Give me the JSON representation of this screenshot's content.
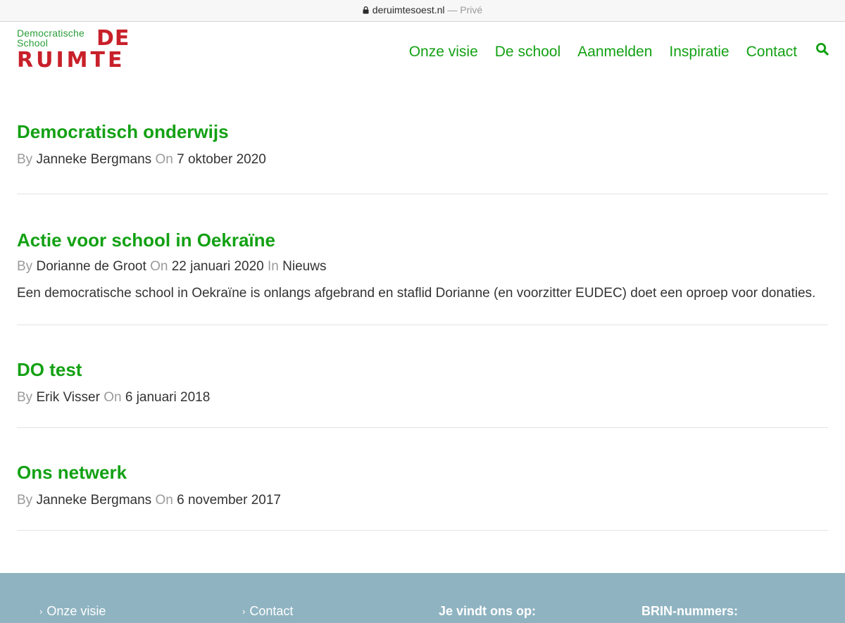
{
  "browser": {
    "url": "deruimtesoest.nl",
    "private_label": "— Privé"
  },
  "logo": {
    "line1": "Democratische",
    "line2": "School",
    "de": "DE",
    "ruimte": "RUIMTE"
  },
  "nav": {
    "items": [
      "Onze visie",
      "De school",
      "Aanmelden",
      "Inspiratie",
      "Contact"
    ]
  },
  "posts": [
    {
      "title": "Democratisch onderwijs",
      "by_label": "By",
      "author": "Janneke Bergmans",
      "on_label": "On",
      "date": "7 oktober 2020"
    },
    {
      "title": "Actie voor school in Oekraïne",
      "by_label": "By",
      "author": "Dorianne de Groot",
      "on_label": "On",
      "date": "22 januari 2020",
      "in_label": "In",
      "category": "Nieuws",
      "excerpt": "Een democratische school in Oekraïne is onlangs afgebrand en staflid Dorianne (en voorzitter EUDEC) doet een oproep voor donaties."
    },
    {
      "title": "DO test",
      "by_label": "By",
      "author": "Erik Visser",
      "on_label": "On",
      "date": "6 januari 2018"
    },
    {
      "title": "Ons netwerk",
      "by_label": "By",
      "author": "Janneke Bergmans",
      "on_label": "On",
      "date": "6 november 2017"
    }
  ],
  "footer": {
    "link1": "Onze visie",
    "link2": "Contact",
    "heading1": "Je vindt ons op:",
    "heading2": "BRIN-nummers:"
  },
  "colors": {
    "accent_green": "#13a114",
    "logo_red": "#c8202a",
    "footer_bg": "#8fb3c1"
  }
}
